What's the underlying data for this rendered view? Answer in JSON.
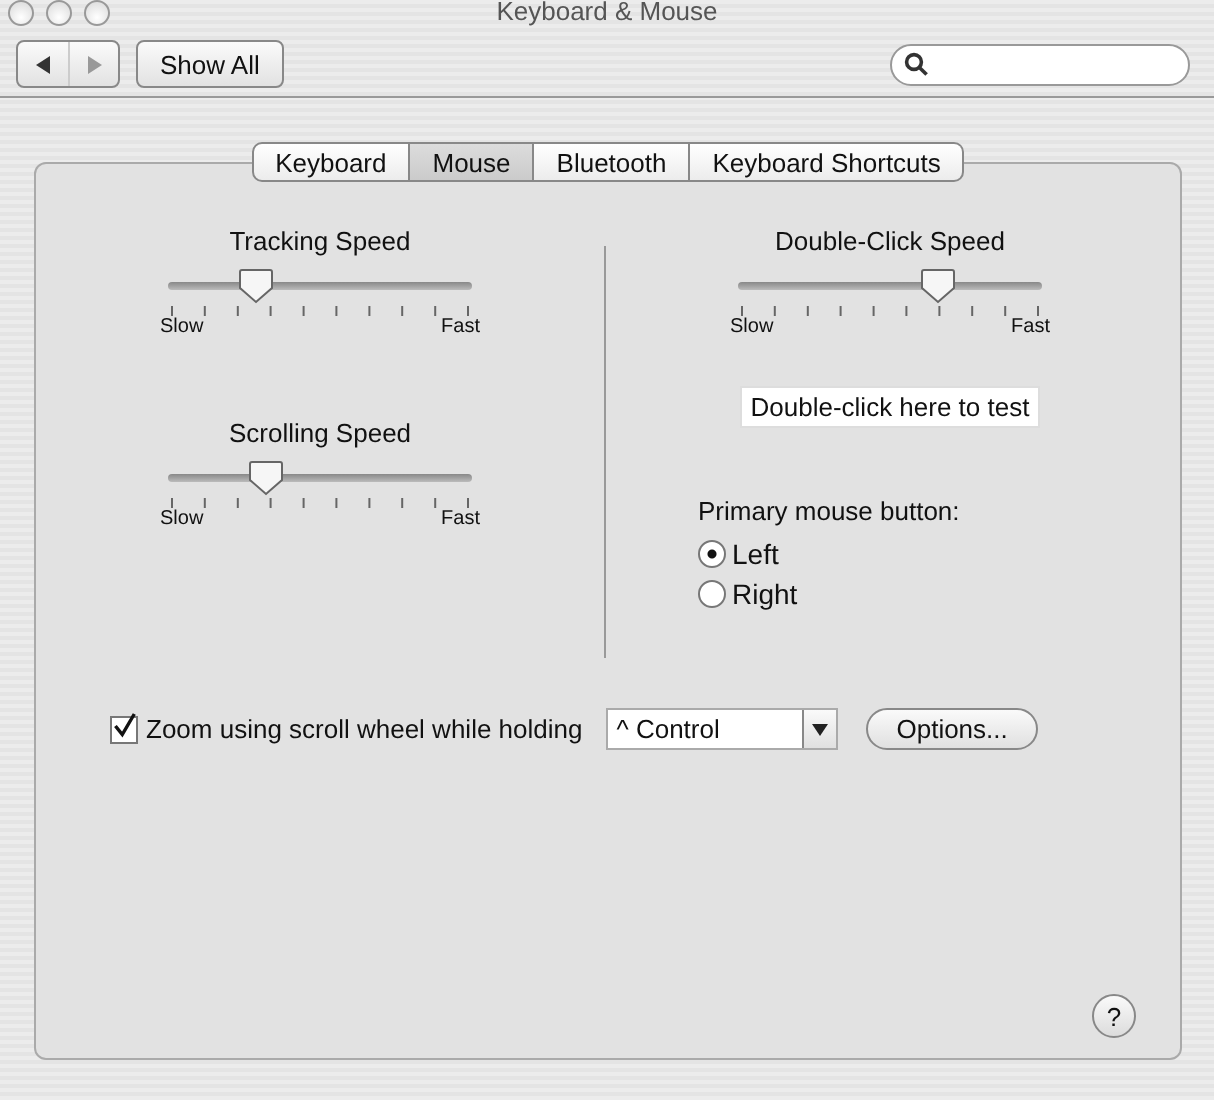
{
  "window": {
    "title": "Keyboard & Mouse"
  },
  "toolbar": {
    "show_all": "Show All"
  },
  "tabs": [
    {
      "label": "Keyboard",
      "selected": false
    },
    {
      "label": "Mouse",
      "selected": true
    },
    {
      "label": "Bluetooth",
      "selected": false
    },
    {
      "label": "Keyboard Shortcuts",
      "selected": false
    }
  ],
  "left_sliders": [
    {
      "title": "Tracking Speed",
      "level": 0.26,
      "min_label": "Slow",
      "max_label": "Fast"
    },
    {
      "title": "Scrolling Speed",
      "level": 0.3,
      "min_label": "Slow",
      "max_label": "Fast"
    }
  ],
  "double_click": {
    "title": "Double-Click Speed",
    "level": 0.68,
    "min_label": "Slow",
    "max_label": "Fast",
    "test_field": "Double-click here to test"
  },
  "primary_button": {
    "label": "Primary mouse button:",
    "options": [
      {
        "label": "Left",
        "selected": true
      },
      {
        "label": "Right",
        "selected": false
      }
    ]
  },
  "zoom": {
    "label": "Zoom using scroll wheel while holding",
    "checked": true,
    "modifier": "^ Control",
    "options_button": "Options..."
  },
  "help": "?"
}
